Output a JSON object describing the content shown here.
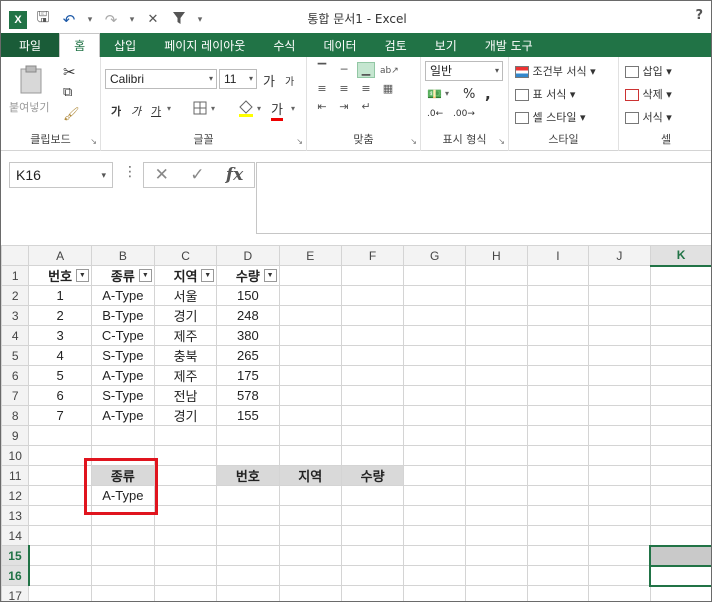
{
  "app": {
    "title": "통합 문서1 - Excel",
    "logo": "X",
    "help": "?"
  },
  "qat": {
    "save_icon": "save-icon",
    "undo_icon": "undo-icon",
    "redo_icon": "redo-icon",
    "close_icon": "close-icon",
    "filter_icon": "filter-icon"
  },
  "tabs": [
    {
      "label": "파일"
    },
    {
      "label": "홈"
    },
    {
      "label": "삽입"
    },
    {
      "label": "페이지 레이아웃"
    },
    {
      "label": "수식"
    },
    {
      "label": "데이터"
    },
    {
      "label": "검토"
    },
    {
      "label": "보기"
    },
    {
      "label": "개발 도구"
    }
  ],
  "ribbon": {
    "clipboard": {
      "label": "클립보드",
      "paste": "붙여넣기"
    },
    "font": {
      "label": "글꼴",
      "name": "Calibri",
      "size": "11",
      "grow": "가",
      "shrink": "가",
      "bold": "가",
      "italic": "가",
      "underline": "가",
      "color_a": "가"
    },
    "align": {
      "label": "맞춤"
    },
    "number": {
      "label": "표시 형식",
      "format": "일반",
      "percent": "%",
      "comma": ","
    },
    "styles": {
      "label": "스타일",
      "conditional": "조건부 서식",
      "table": "표 서식",
      "cell": "셀 스타일"
    },
    "cells": {
      "label": "셀",
      "insert": "삽입",
      "delete": "삭제",
      "format": "서식"
    }
  },
  "formula_bar": {
    "name_box": "K16",
    "value": ""
  },
  "sheet": {
    "columns": [
      "A",
      "B",
      "C",
      "D",
      "E",
      "F",
      "G",
      "H",
      "I",
      "J",
      "K"
    ],
    "header_row": [
      "번호",
      "종류",
      "지역",
      "수량"
    ],
    "data_rows": [
      [
        "1",
        "A-Type",
        "서울",
        "150"
      ],
      [
        "2",
        "B-Type",
        "경기",
        "248"
      ],
      [
        "3",
        "C-Type",
        "제주",
        "380"
      ],
      [
        "4",
        "S-Type",
        "충북",
        "265"
      ],
      [
        "5",
        "A-Type",
        "제주",
        "175"
      ],
      [
        "6",
        "S-Type",
        "전남",
        "578"
      ],
      [
        "7",
        "A-Type",
        "경기",
        "155"
      ]
    ],
    "criteria": {
      "header": "종류",
      "value": "A-Type"
    },
    "extract_headers": [
      "번호",
      "지역",
      "수량"
    ],
    "row_numbers": [
      "1",
      "2",
      "3",
      "4",
      "5",
      "6",
      "7",
      "8",
      "9",
      "10",
      "11",
      "12",
      "13",
      "14",
      "15",
      "16",
      "17"
    ]
  }
}
